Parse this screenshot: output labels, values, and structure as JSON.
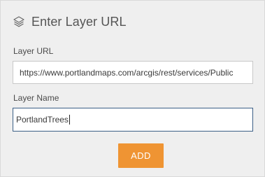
{
  "header": {
    "icon": "layers-icon",
    "title": "Enter Layer URL"
  },
  "form": {
    "url_label": "Layer URL",
    "url_value": "https://www.portlandmaps.com/arcgis/rest/services/Public",
    "name_label": "Layer Name",
    "name_value": "PortlandTrees"
  },
  "actions": {
    "add_label": "ADD",
    "add_color": "#ef9433"
  }
}
